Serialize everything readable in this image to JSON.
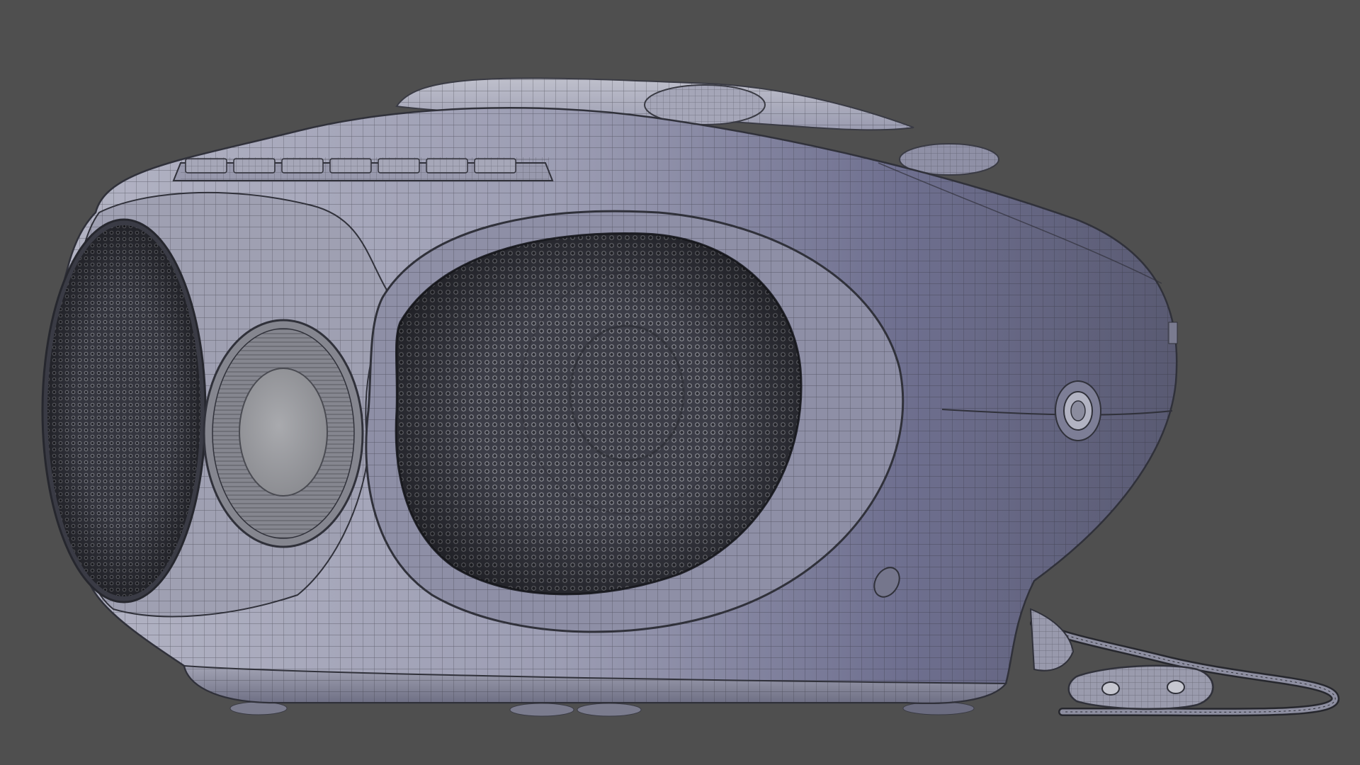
{
  "scene": {
    "background_color": "#4f4f4f",
    "subject": "boombox-wireframe-render",
    "colors": {
      "body_light": "#a8a9c2",
      "body_mid": "#8d8ea8",
      "body_dark": "#5e5f76",
      "wire": "#2f3038",
      "grille": "#3a3b45",
      "cd_disc": "#9a9b9e"
    }
  }
}
